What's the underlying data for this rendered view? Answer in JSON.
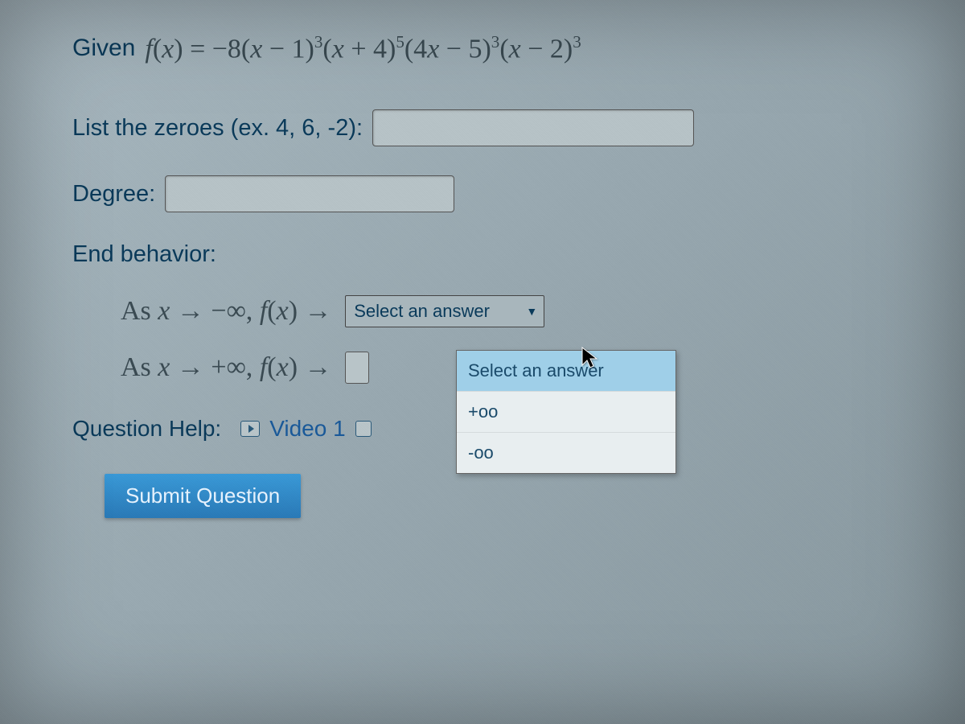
{
  "problem": {
    "given_prefix": "Given",
    "function_html": "f(x) = −8(x − 1)<sup>3</sup>(x + 4)<sup>5</sup>(4x − 5)<sup>3</sup>(x − 2)<sup>3</sup>",
    "zeroes_label": "List the zeroes (ex. 4, 6, -2):",
    "zeroes_value": "",
    "degree_label": "Degree:",
    "degree_value": "",
    "end_behavior_label": "End behavior:",
    "eb_row1_prefix": "As x → −∞, f(x) →",
    "eb_row2_prefix": "As x → +∞, f(x) →",
    "select_placeholder": "Select an answer",
    "dropdown_options": [
      "Select an answer",
      "+oo",
      "-oo"
    ],
    "question_help_label": "Question Help:",
    "video_link": "Video 1",
    "submit_label": "Submit Question"
  }
}
